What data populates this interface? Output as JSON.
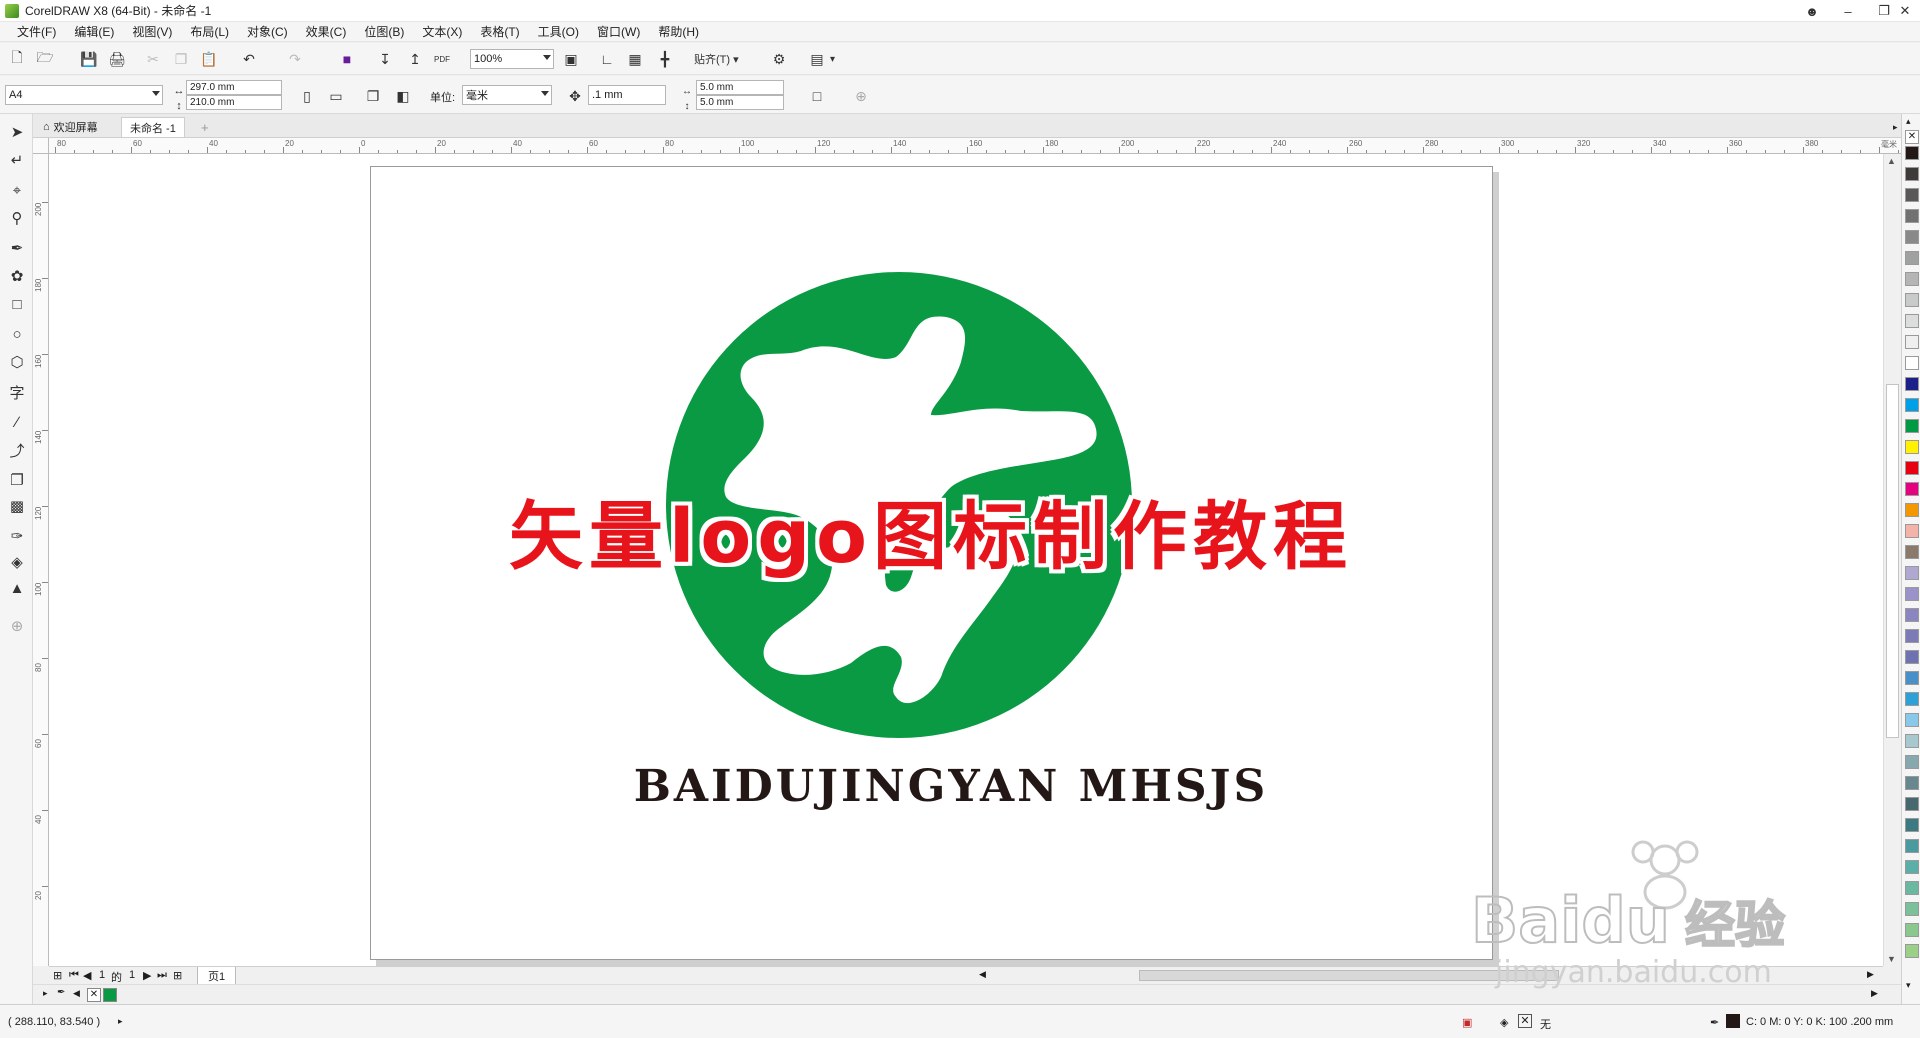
{
  "window": {
    "title": "CorelDRAW X8 (64-Bit) - 未命名 -1",
    "controls": [
      "restore-icon",
      "minimize-icon",
      "maximize-icon",
      "close-icon"
    ]
  },
  "menu": [
    "文件(F)",
    "编辑(E)",
    "视图(V)",
    "布局(L)",
    "对象(C)",
    "效果(C)",
    "位图(B)",
    "文本(X)",
    "表格(T)",
    "工具(O)",
    "窗口(W)",
    "帮助(H)"
  ],
  "toolbar": {
    "zoom": "100%",
    "snap_label": "贴齐(T)",
    "pdf_label": "PDF"
  },
  "propbar": {
    "paper_size": "A4",
    "width": "297.0 mm",
    "height": "210.0 mm",
    "units_label": "单位:",
    "units_value": "毫米",
    "nudge": ".1 mm",
    "dup_x": "5.0 mm",
    "dup_y": "5.0 mm"
  },
  "tabs": {
    "welcome": "欢迎屏幕",
    "document": "未命名 -1"
  },
  "ruler": {
    "h_labels": [
      "80",
      "60",
      "40",
      "20",
      "0",
      "20",
      "40",
      "60",
      "80",
      "100",
      "120",
      "140",
      "160",
      "180",
      "200",
      "220",
      "240",
      "260",
      "280",
      "300",
      "320",
      "340",
      "360",
      "380",
      "毫米"
    ],
    "v_labels": [
      "200",
      "180",
      "160",
      "140",
      "120",
      "100",
      "80",
      "60",
      "40",
      "20"
    ]
  },
  "artwork": {
    "headline": "矢量logo图标制作教程",
    "caption": "BAIDUJINGYAN MHSJS",
    "colors": {
      "logo_green": "#0a9a44",
      "headline_red": "#e8141c",
      "caption_dark": "#231815"
    }
  },
  "pagenav": {
    "current": "1",
    "of_label": "的",
    "total": "1",
    "page_tab": "页1"
  },
  "status": {
    "coords": "( 288.110, 83.540 )",
    "fill_none": "无",
    "outline": "C: 0 M: 0 Y: 0 K: 100  .200 mm"
  },
  "palette": [
    "#231815",
    "#3e3a39",
    "#595757",
    "#727171",
    "#898989",
    "#9fa0a0",
    "#b5b5b6",
    "#c9caca",
    "#dcdddd",
    "#efefef",
    "#ffffff",
    "#1d2088",
    "#00a0e9",
    "#009944",
    "#fff100",
    "#e60012",
    "#e4007f",
    "#f39800",
    "#f4b3a8",
    "#8a7a6b",
    "#b0a8d0",
    "#9a92c8",
    "#8c86c0",
    "#7d7ab8",
    "#6e72b0",
    "#4a90c8",
    "#2ea0d8",
    "#88c8e8",
    "#a8c8d0",
    "#88a8b0",
    "#688890",
    "#486870",
    "#3a7a80",
    "#4a9aa0",
    "#5ab0a8",
    "#6ab8a0",
    "#7ac098",
    "#8ac890",
    "#9ad088"
  ],
  "watermark": {
    "brand": "Baidu",
    "cn": "经验",
    "url": "jingyan.baidu.com"
  }
}
